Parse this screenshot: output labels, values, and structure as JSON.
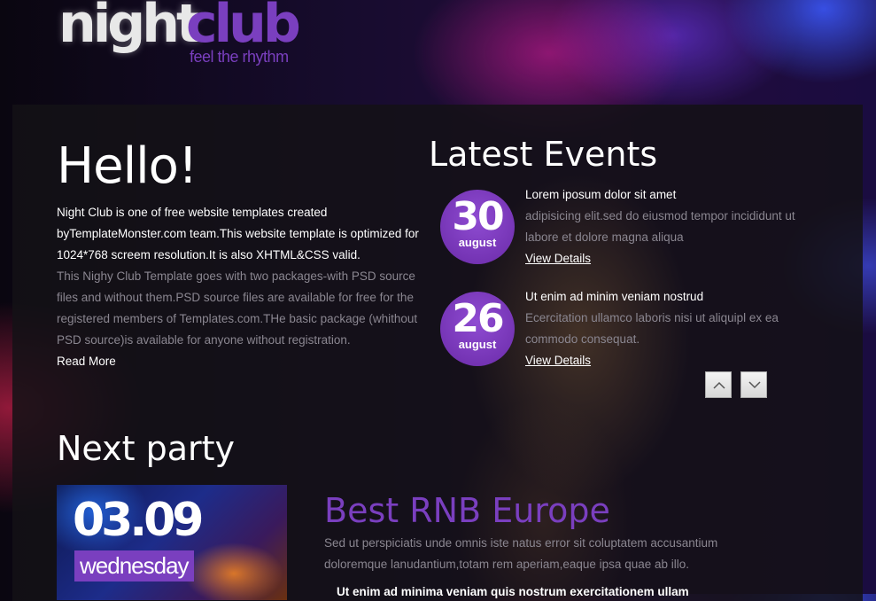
{
  "logo": {
    "night": "night",
    "club": "club",
    "tagline": "feel the rhythm"
  },
  "hello": {
    "title": "Hello!",
    "lead": "Night Club is one of free website templates created byTemplateMonster.com team.This website template is optimized for 1024*768 screem resolution.It is also XHTML&CSS valid.",
    "body": "This Nighy Club Template goes with two packages-with PSD source files and without them.PSD source files are available for free for the registered members of Templates.com.THe basic package (whithout PSD source)is available for anyone without registration.",
    "read_more": "Read More"
  },
  "events": {
    "title": "Latest Events",
    "items": [
      {
        "day": "30",
        "month": "august",
        "heading": "Lorem iposum dolor sit amet",
        "description": "adipisicing elit.sed do eiusmod tempor incididunt ut labore et dolore magna aliqua",
        "details": "View Details"
      },
      {
        "day": "26",
        "month": "august",
        "heading": "Ut enim ad minim veniam nostrud",
        "description": "Ecercitation ullamco laboris nisi ut aliquipl ex ea commodo consequat.",
        "details": "View Details"
      }
    ],
    "controls": {
      "up_icon": "chevron-up-icon",
      "down_icon": "chevron-down-icon"
    }
  },
  "next_party": {
    "title": "Next party",
    "date": "03.09",
    "weekday": "wednesday",
    "event_title": "Best RNB Europe",
    "description": "Sed ut perspiciatis unde omnis iste natus error sit coluptatem accusantium doloremque lanudantium,totam rem aperiam,eaque ipsa quae ab illo.",
    "bullet": "Ut enim ad minima veniam quis nostrum exercitationem ullam"
  },
  "colors": {
    "accent": "#7a3fbf",
    "badge": "#7e3fc2",
    "panel": "#141216",
    "muted_text": "#8a8690"
  }
}
